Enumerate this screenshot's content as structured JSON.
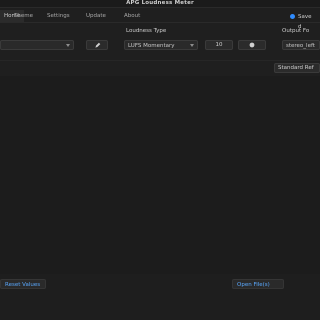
{
  "window": {
    "title": "APG Loudness Meter"
  },
  "tabs": [
    {
      "label": "Home"
    },
    {
      "label": "Theme"
    },
    {
      "label": "Settings"
    },
    {
      "label": "Update"
    },
    {
      "label": "About"
    }
  ],
  "mode_radio": {
    "label": "Save d"
  },
  "controls": {
    "input_field": {
      "value": ""
    },
    "edit_icon": "pencil-icon",
    "loudness_type": {
      "label": "Loudness Type",
      "value": "LUFS Momentary"
    },
    "value_button": {
      "label": "10"
    },
    "record_icon": "record-icon",
    "output_format": {
      "label": "Output Fo",
      "value": "stereo_left"
    },
    "standard_ref": {
      "label": "Standard Ref"
    }
  },
  "footer": {
    "left_button": {
      "label": "Reset Values"
    },
    "right_button": {
      "label": "Open File(s)"
    }
  },
  "colors": {
    "accent": "#2f8cff",
    "link": "#5aa9ff"
  }
}
